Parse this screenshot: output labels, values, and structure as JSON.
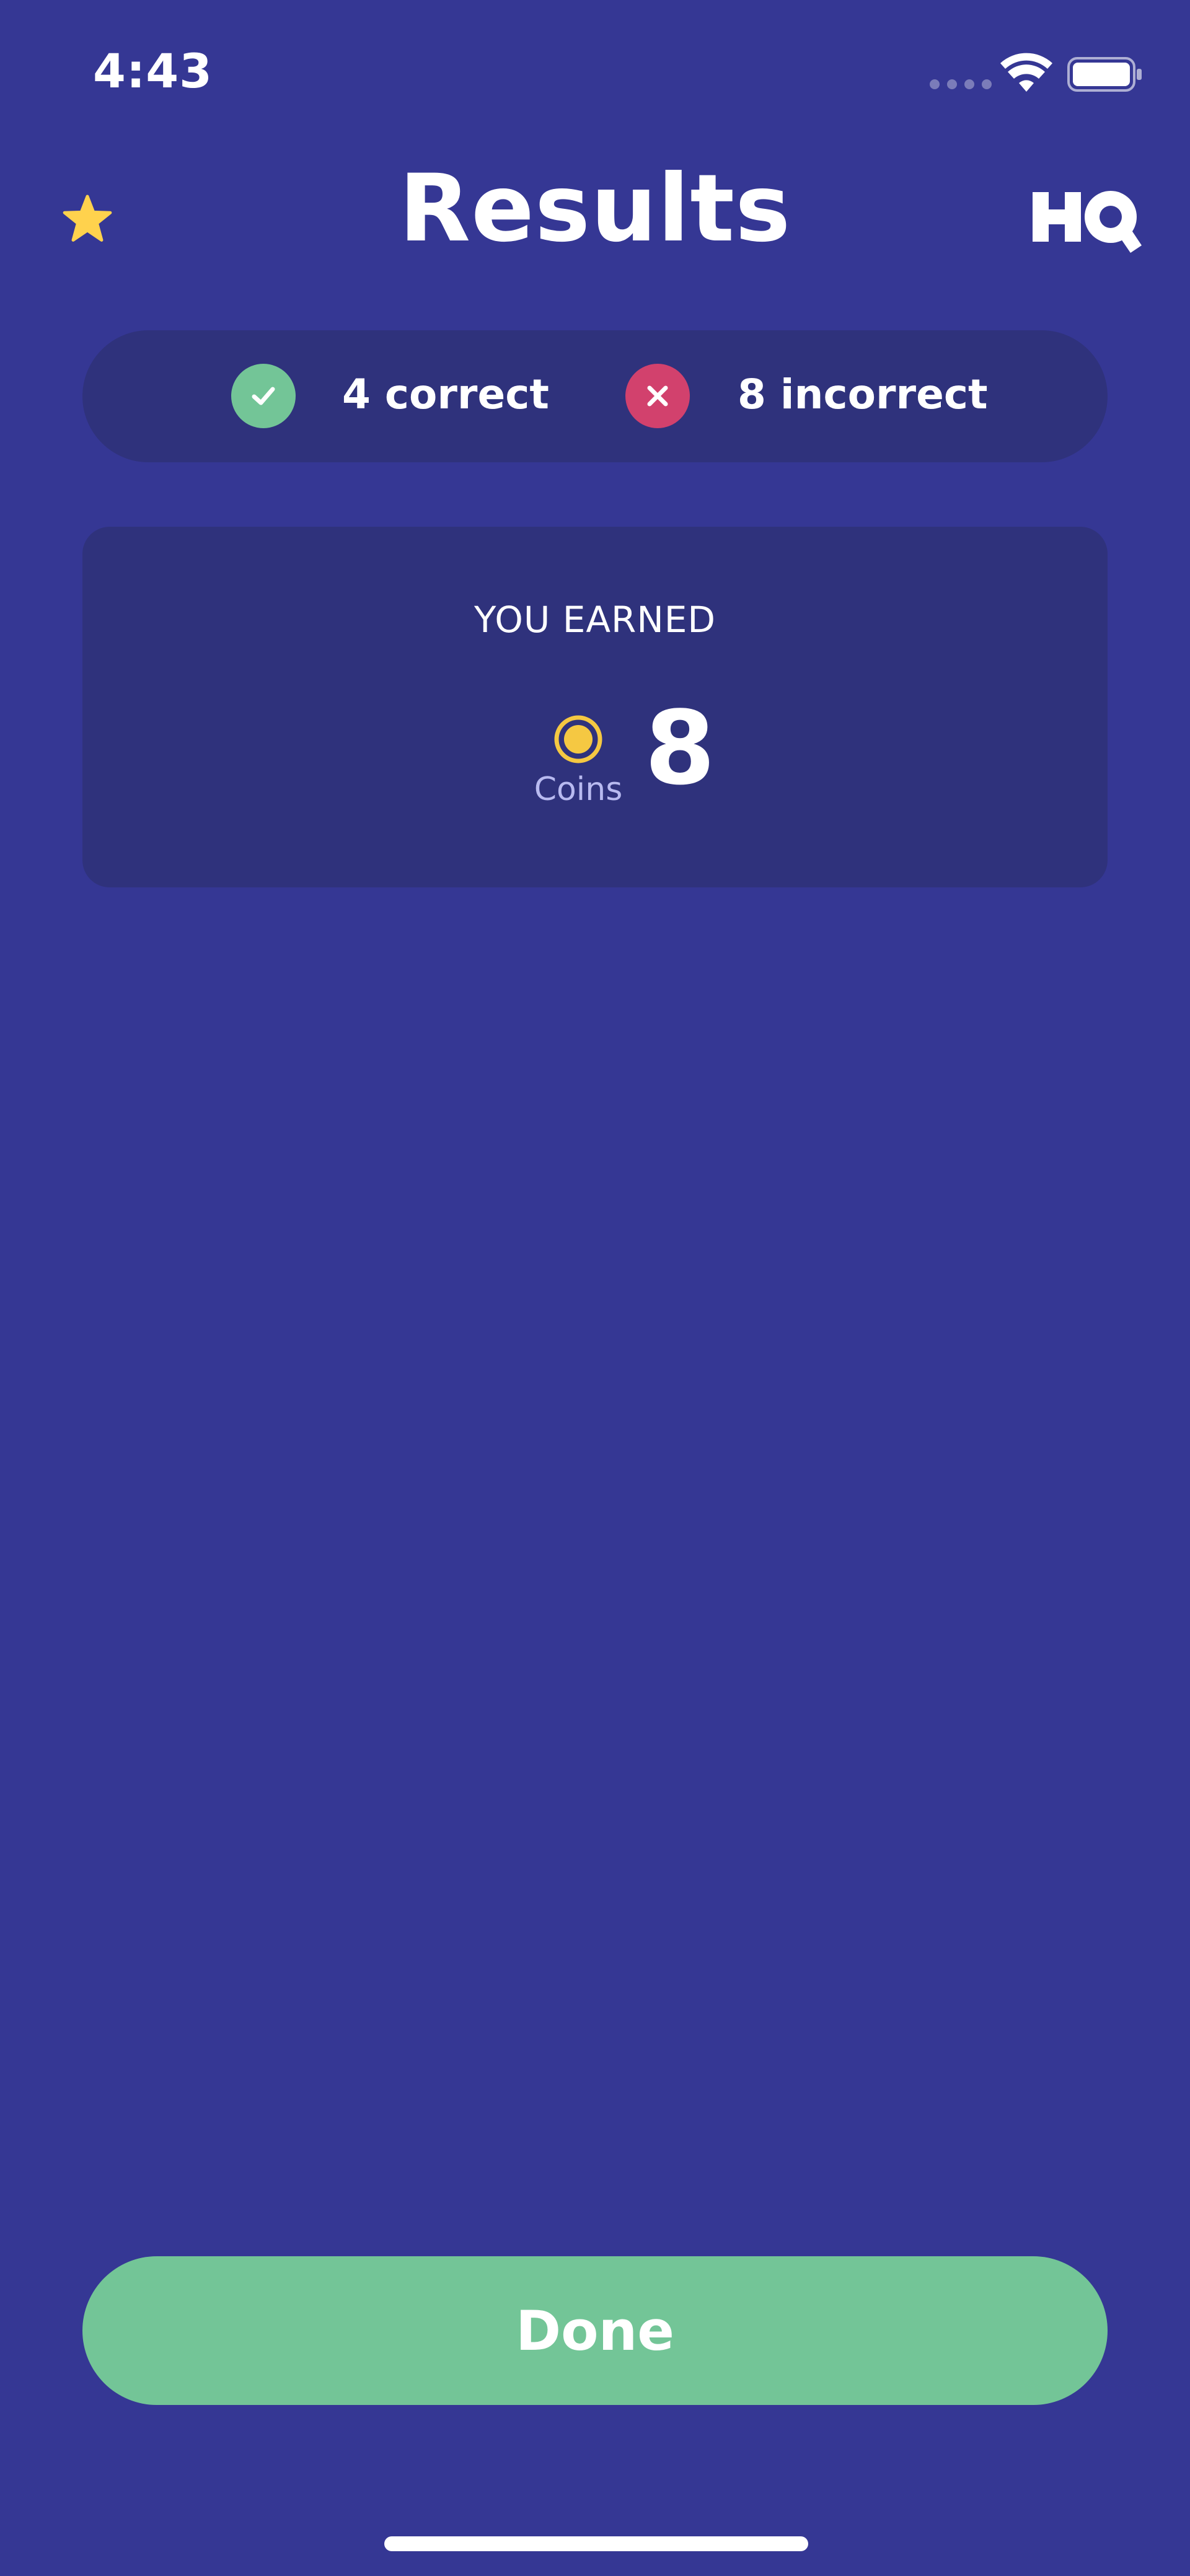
{
  "status_bar": {
    "time": "4:43",
    "icons": [
      "cellular-signal-icon",
      "wifi-icon",
      "battery-icon"
    ]
  },
  "header": {
    "title": "Results",
    "left_icon": "star-icon",
    "logo_text": "HQ"
  },
  "score": {
    "correct_label": "4 correct",
    "incorrect_label": "8 incorrect",
    "correct_icon": "checkmark-icon",
    "incorrect_icon": "x-icon"
  },
  "earned": {
    "heading": "YOU EARNED",
    "currency_label": "Coins",
    "amount": "8",
    "currency_icon": "coin-icon"
  },
  "actions": {
    "done_label": "Done"
  },
  "colors": {
    "background": "#353794",
    "card": "#2f327c",
    "correct": "#73c597",
    "incorrect": "#d2416d",
    "coin": "#f5c842",
    "star": "#ffd24d"
  }
}
